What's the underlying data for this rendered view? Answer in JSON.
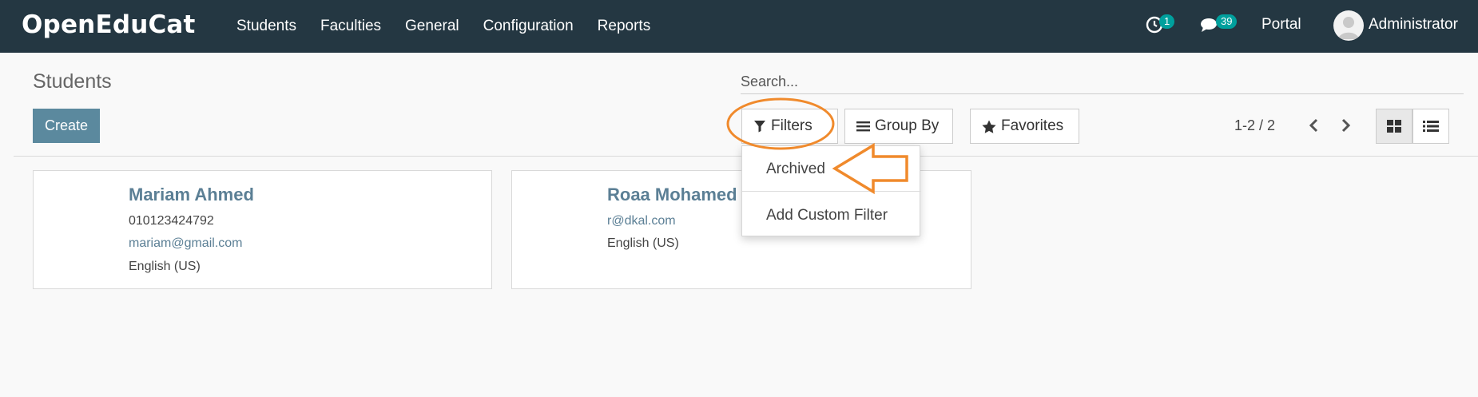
{
  "navbar": {
    "brand": "OpenEduCat",
    "menu": [
      "Students",
      "Faculties",
      "General",
      "Configuration",
      "Reports"
    ],
    "activity_badge": "1",
    "messages_badge": "39",
    "portal": "Portal",
    "user": "Administrator"
  },
  "control_panel": {
    "title": "Students",
    "create_label": "Create",
    "search_placeholder": "Search...",
    "filters_label": "Filters",
    "group_by_label": "Group By",
    "favorites_label": "Favorites",
    "pager": "1-2 / 2"
  },
  "filters_dropdown": {
    "items": [
      "Archived",
      "Add Custom Filter"
    ]
  },
  "students": [
    {
      "name": "Mariam Ahmed",
      "phone": "010123424792",
      "email": "mariam@gmail.com",
      "lang": "English (US)"
    },
    {
      "name": "Roaa Mohamed",
      "email": "r@dkal.com",
      "lang": "English (US)"
    }
  ],
  "colors": {
    "navbar": "#243742",
    "accent": "#5b899e",
    "badge": "#00a09d",
    "annotation": "#f08a2c"
  }
}
